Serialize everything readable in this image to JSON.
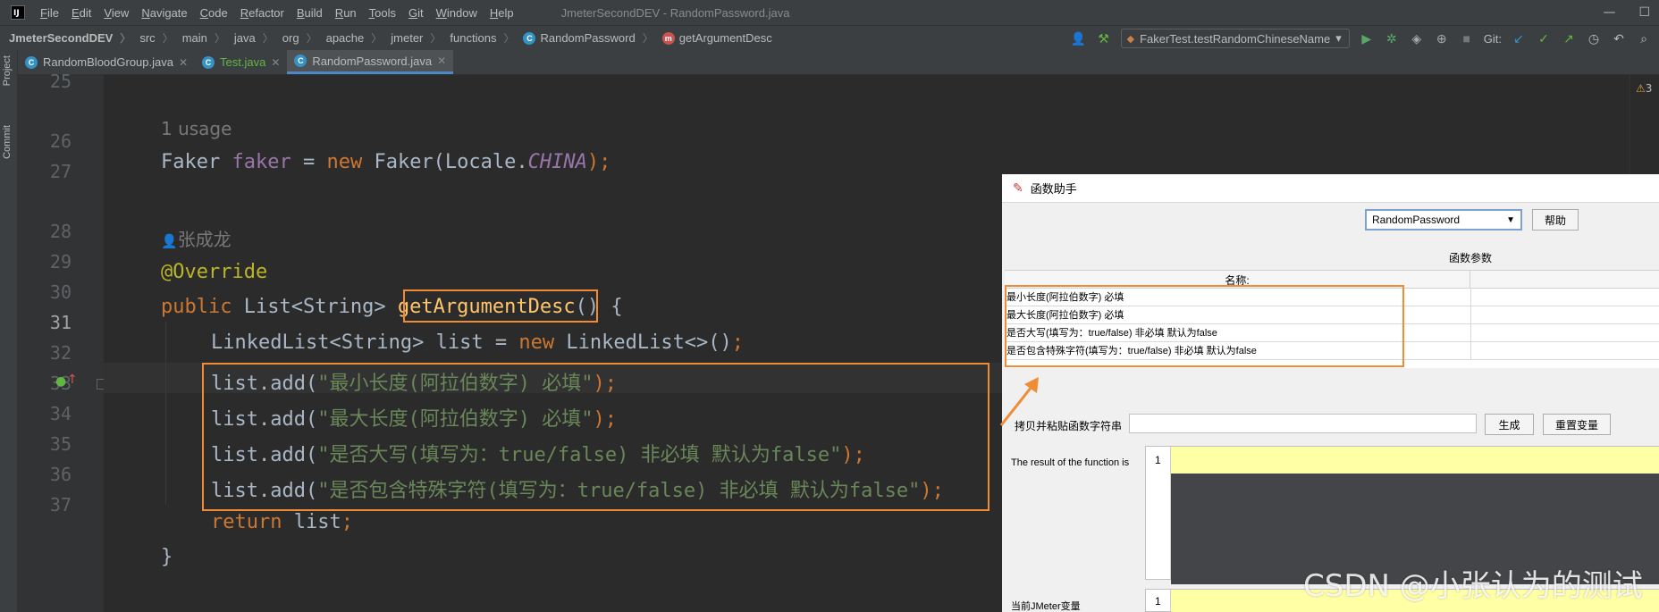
{
  "menubar": {
    "items": [
      "File",
      "Edit",
      "View",
      "Navigate",
      "Code",
      "Refactor",
      "Build",
      "Run",
      "Tools",
      "Git",
      "Window",
      "Help"
    ],
    "window_title": "JmeterSecondDEV - RandomPassword.java"
  },
  "navbar": {
    "breadcrumbs": [
      "JmeterSecondDEV",
      "src",
      "main",
      "java",
      "org",
      "apache",
      "jmeter",
      "functions",
      "RandomPassword",
      "getArgumentDesc"
    ],
    "run_config": "FakerTest.testRandomChineseName",
    "git_label": "Git:"
  },
  "left_strip": {
    "project": "Project",
    "commit": "Commit"
  },
  "tabs": [
    {
      "label": "RandomBloodGroup.java",
      "active": false
    },
    {
      "label": "Test.java",
      "active": false
    },
    {
      "label": "RandomPassword.java",
      "active": true
    }
  ],
  "editor": {
    "line_numbers": [
      "25",
      "26",
      "27",
      "28",
      "29",
      "30",
      "31",
      "32",
      "33",
      "34",
      "35",
      "36",
      "37"
    ],
    "current_line": "31",
    "hint_usage": "1 usage",
    "hint_author": "张成龙",
    "code": {
      "l26_type": "Faker ",
      "l26_field": "faker",
      "l26_eq": " = ",
      "l26_new": "new ",
      "l26_ctor": "Faker(Locale.",
      "l26_const": "CHINA",
      "l26_end": ");",
      "l28": "@Override",
      "l29_kw": "public ",
      "l29_type": "List<String> ",
      "l29_fn": "getArgumentDesc",
      "l29_end": "() {",
      "l30_type": "LinkedList<String> list = ",
      "l30_new": "new ",
      "l30_ctor": "LinkedList<>()",
      "l30_end": ";",
      "l31_pre": "list.add(",
      "l31_str": "\"最小长度(阿拉伯数字) 必填\"",
      "l31_end": ");",
      "l32_pre": "list.add(",
      "l32_str": "\"最大长度(阿拉伯数字) 必填\"",
      "l32_end": ");",
      "l33_pre": "list.add(",
      "l33_str": "\"是否大写(填写为：true/false) 非必填 默认为false\"",
      "l33_end": ");",
      "l34_pre": "list.add(",
      "l34_str": "\"是否包含特殊字符(填写为：true/false) 非必填 默认为false\"",
      "l34_end": ");",
      "l35_kw": "return ",
      "l35_rest": "list",
      "l35_end": ";",
      "l36": "}"
    },
    "warning_count": "3"
  },
  "dialog": {
    "title": "函数助手",
    "function_select": "RandomPassword",
    "help_button": "帮助",
    "params_heading": "函数参数",
    "name_column": "名称:",
    "params": [
      "最小长度(阿拉伯数字) 必填",
      "最大长度(阿拉伯数字) 必填",
      "是否大写(填写为：true/false) 非必填 默认为false",
      "是否包含特殊字符(填写为：true/false) 非必填 默认为false"
    ],
    "copy_label": "拷贝并粘贴函数字符串",
    "generate_button": "生成",
    "reset_button": "重置变量",
    "result_label": "The result of the function is",
    "result_line": "1",
    "vars_label": "当前JMeter变量",
    "vars_line": "1"
  },
  "watermark": "CSDN @小张认为的测试",
  "colors": {
    "highlight_box": "#f08b36",
    "editor_bg": "#2b2b2b",
    "string": "#6a8759",
    "keyword": "#cc7832"
  }
}
